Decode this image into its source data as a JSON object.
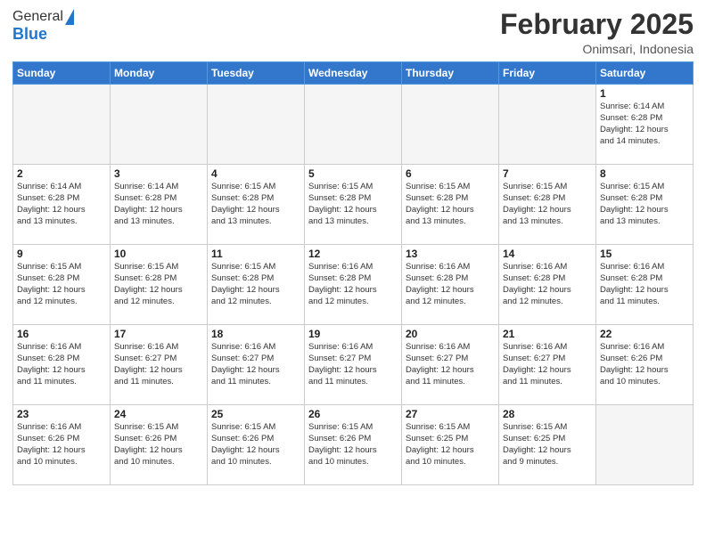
{
  "header": {
    "logo_general": "General",
    "logo_blue": "Blue",
    "month": "February 2025",
    "location": "Onimsari, Indonesia"
  },
  "weekdays": [
    "Sunday",
    "Monday",
    "Tuesday",
    "Wednesday",
    "Thursday",
    "Friday",
    "Saturday"
  ],
  "weeks": [
    [
      {
        "day": "",
        "info": ""
      },
      {
        "day": "",
        "info": ""
      },
      {
        "day": "",
        "info": ""
      },
      {
        "day": "",
        "info": ""
      },
      {
        "day": "",
        "info": ""
      },
      {
        "day": "",
        "info": ""
      },
      {
        "day": "1",
        "info": "Sunrise: 6:14 AM\nSunset: 6:28 PM\nDaylight: 12 hours\nand 14 minutes."
      }
    ],
    [
      {
        "day": "2",
        "info": "Sunrise: 6:14 AM\nSunset: 6:28 PM\nDaylight: 12 hours\nand 13 minutes."
      },
      {
        "day": "3",
        "info": "Sunrise: 6:14 AM\nSunset: 6:28 PM\nDaylight: 12 hours\nand 13 minutes."
      },
      {
        "day": "4",
        "info": "Sunrise: 6:15 AM\nSunset: 6:28 PM\nDaylight: 12 hours\nand 13 minutes."
      },
      {
        "day": "5",
        "info": "Sunrise: 6:15 AM\nSunset: 6:28 PM\nDaylight: 12 hours\nand 13 minutes."
      },
      {
        "day": "6",
        "info": "Sunrise: 6:15 AM\nSunset: 6:28 PM\nDaylight: 12 hours\nand 13 minutes."
      },
      {
        "day": "7",
        "info": "Sunrise: 6:15 AM\nSunset: 6:28 PM\nDaylight: 12 hours\nand 13 minutes."
      },
      {
        "day": "8",
        "info": "Sunrise: 6:15 AM\nSunset: 6:28 PM\nDaylight: 12 hours\nand 13 minutes."
      }
    ],
    [
      {
        "day": "9",
        "info": "Sunrise: 6:15 AM\nSunset: 6:28 PM\nDaylight: 12 hours\nand 12 minutes."
      },
      {
        "day": "10",
        "info": "Sunrise: 6:15 AM\nSunset: 6:28 PM\nDaylight: 12 hours\nand 12 minutes."
      },
      {
        "day": "11",
        "info": "Sunrise: 6:15 AM\nSunset: 6:28 PM\nDaylight: 12 hours\nand 12 minutes."
      },
      {
        "day": "12",
        "info": "Sunrise: 6:16 AM\nSunset: 6:28 PM\nDaylight: 12 hours\nand 12 minutes."
      },
      {
        "day": "13",
        "info": "Sunrise: 6:16 AM\nSunset: 6:28 PM\nDaylight: 12 hours\nand 12 minutes."
      },
      {
        "day": "14",
        "info": "Sunrise: 6:16 AM\nSunset: 6:28 PM\nDaylight: 12 hours\nand 12 minutes."
      },
      {
        "day": "15",
        "info": "Sunrise: 6:16 AM\nSunset: 6:28 PM\nDaylight: 12 hours\nand 11 minutes."
      }
    ],
    [
      {
        "day": "16",
        "info": "Sunrise: 6:16 AM\nSunset: 6:28 PM\nDaylight: 12 hours\nand 11 minutes."
      },
      {
        "day": "17",
        "info": "Sunrise: 6:16 AM\nSunset: 6:27 PM\nDaylight: 12 hours\nand 11 minutes."
      },
      {
        "day": "18",
        "info": "Sunrise: 6:16 AM\nSunset: 6:27 PM\nDaylight: 12 hours\nand 11 minutes."
      },
      {
        "day": "19",
        "info": "Sunrise: 6:16 AM\nSunset: 6:27 PM\nDaylight: 12 hours\nand 11 minutes."
      },
      {
        "day": "20",
        "info": "Sunrise: 6:16 AM\nSunset: 6:27 PM\nDaylight: 12 hours\nand 11 minutes."
      },
      {
        "day": "21",
        "info": "Sunrise: 6:16 AM\nSunset: 6:27 PM\nDaylight: 12 hours\nand 11 minutes."
      },
      {
        "day": "22",
        "info": "Sunrise: 6:16 AM\nSunset: 6:26 PM\nDaylight: 12 hours\nand 10 minutes."
      }
    ],
    [
      {
        "day": "23",
        "info": "Sunrise: 6:16 AM\nSunset: 6:26 PM\nDaylight: 12 hours\nand 10 minutes."
      },
      {
        "day": "24",
        "info": "Sunrise: 6:15 AM\nSunset: 6:26 PM\nDaylight: 12 hours\nand 10 minutes."
      },
      {
        "day": "25",
        "info": "Sunrise: 6:15 AM\nSunset: 6:26 PM\nDaylight: 12 hours\nand 10 minutes."
      },
      {
        "day": "26",
        "info": "Sunrise: 6:15 AM\nSunset: 6:26 PM\nDaylight: 12 hours\nand 10 minutes."
      },
      {
        "day": "27",
        "info": "Sunrise: 6:15 AM\nSunset: 6:25 PM\nDaylight: 12 hours\nand 10 minutes."
      },
      {
        "day": "28",
        "info": "Sunrise: 6:15 AM\nSunset: 6:25 PM\nDaylight: 12 hours\nand 9 minutes."
      },
      {
        "day": "",
        "info": ""
      }
    ]
  ]
}
